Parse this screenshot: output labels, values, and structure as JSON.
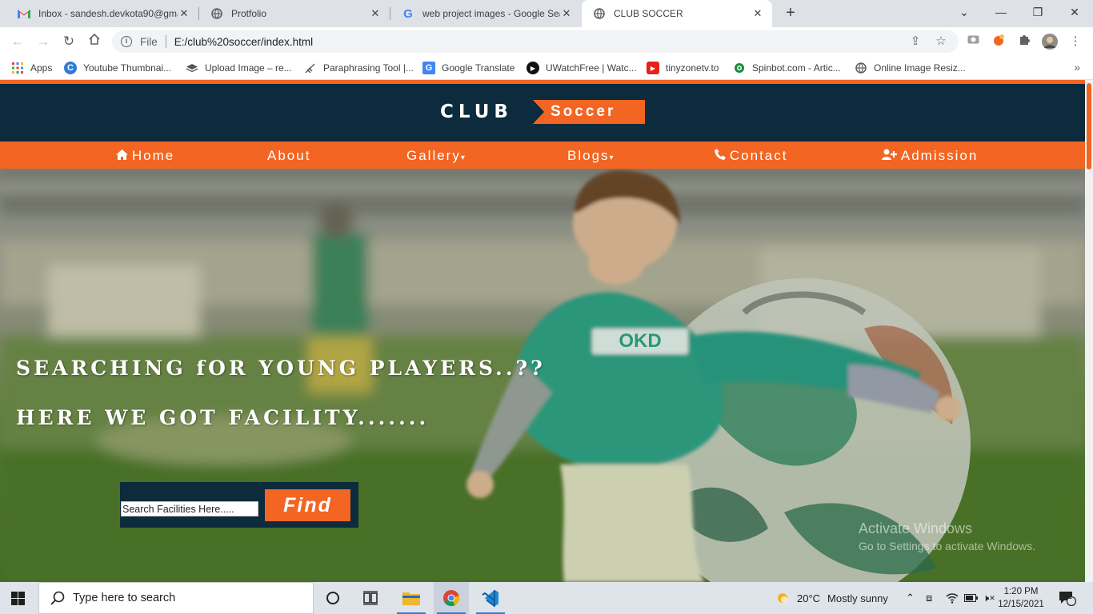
{
  "browser": {
    "tabs": [
      {
        "title": "Inbox - sandesh.devkota90@gma",
        "icon": "gmail-icon",
        "active": false
      },
      {
        "title": "Protfolio",
        "icon": "globe-icon",
        "active": false
      },
      {
        "title": "web project images - Google Sea",
        "icon": "google-icon",
        "active": false
      },
      {
        "title": "CLUB SOCCER",
        "icon": "globe-icon",
        "active": true
      }
    ],
    "new_tab": "+",
    "address": {
      "scheme_label": "File",
      "url": "E:/club%20soccer/index.html"
    },
    "bookmarks": [
      {
        "label": "Apps",
        "icon": "apps-grid-icon"
      },
      {
        "label": "Youtube Thumbnai...",
        "icon": "canva-icon"
      },
      {
        "label": "Upload Image – re...",
        "icon": "layers-icon"
      },
      {
        "label": "Paraphrasing Tool |...",
        "icon": "quill-icon"
      },
      {
        "label": "Google Translate",
        "icon": "translate-icon"
      },
      {
        "label": "UWatchFree | Watc...",
        "icon": "play-circle-icon"
      },
      {
        "label": "tinyzonetv.to",
        "icon": "youtube-play-icon"
      },
      {
        "label": "Spinbot.com - Artic...",
        "icon": "spinbot-icon"
      },
      {
        "label": "Online Image Resiz...",
        "icon": "globe-icon"
      }
    ],
    "bookmarks_more": "»"
  },
  "site": {
    "logo_club": "CLUB",
    "logo_soccer": "Soccer",
    "nav": [
      {
        "label": "Home",
        "icon": "home-icon"
      },
      {
        "label": "About"
      },
      {
        "label": "Gallery",
        "caret": "▾"
      },
      {
        "label": "Blogs",
        "caret": "▾"
      },
      {
        "label": "Contact",
        "icon": "phone-icon"
      },
      {
        "label": "Admission",
        "icon": "user-plus-icon"
      }
    ],
    "hero": {
      "line1": "SEARCHING fOR YOUNG PLAYERS..??",
      "line2": "HERE WE GOT FACILITY.......",
      "jersey_text": "OKD"
    },
    "search": {
      "placeholder": "Search Facilities Here.....",
      "button": "Find"
    }
  },
  "watermark": {
    "line1": "Activate Windows",
    "line2": "Go to Settings to activate Windows."
  },
  "taskbar": {
    "search_placeholder": "Type here to search",
    "weather": {
      "temp": "20°C",
      "condition": "Mostly sunny"
    },
    "time": "1:20 PM",
    "date": "12/15/2021",
    "notifications": "1"
  },
  "colors": {
    "accent": "#f26522",
    "navy": "#0c2b3c"
  }
}
